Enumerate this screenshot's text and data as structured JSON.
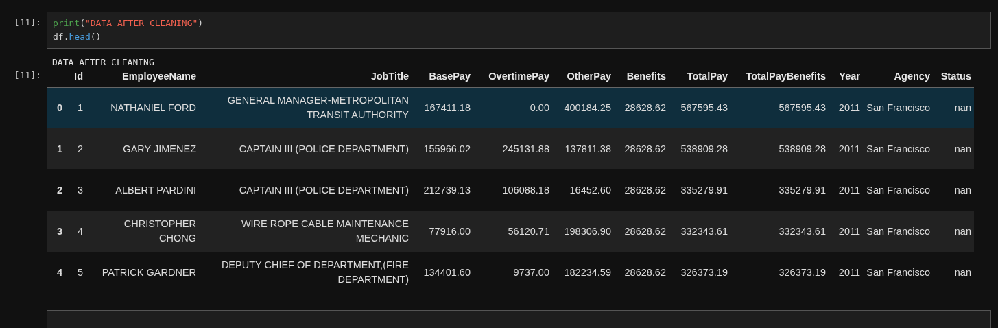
{
  "code_cell": {
    "prompt": "[11]:",
    "lines": [
      [
        {
          "kind": "func",
          "text": "print"
        },
        {
          "kind": "punct",
          "text": "("
        },
        {
          "kind": "string",
          "text": "\"DATA AFTER CLEANING\""
        },
        {
          "kind": "punct",
          "text": ")"
        }
      ],
      [
        {
          "kind": "plain",
          "text": "df."
        },
        {
          "kind": "method",
          "text": "head"
        },
        {
          "kind": "punct",
          "text": "()"
        }
      ]
    ]
  },
  "stdout": "DATA AFTER CLEANING",
  "output": {
    "prompt": "[11]:",
    "table": {
      "columns": [
        "",
        "Id",
        "EmployeeName",
        "JobTitle",
        "BasePay",
        "OvertimePay",
        "OtherPay",
        "Benefits",
        "TotalPay",
        "TotalPayBenefits",
        "Year",
        "Agency",
        "Status"
      ],
      "rows": [
        {
          "selected": true,
          "cells": [
            "0",
            "1",
            "NATHANIEL FORD",
            "GENERAL MANAGER-METROPOLITAN TRANSIT AUTHORITY",
            "167411.18",
            "0.00",
            "400184.25",
            "28628.62",
            "567595.43",
            "567595.43",
            "2011",
            "San Francisco",
            "nan"
          ]
        },
        {
          "selected": false,
          "cells": [
            "1",
            "2",
            "GARY JIMENEZ",
            "CAPTAIN III (POLICE DEPARTMENT)",
            "155966.02",
            "245131.88",
            "137811.38",
            "28628.62",
            "538909.28",
            "538909.28",
            "2011",
            "San Francisco",
            "nan"
          ]
        },
        {
          "selected": false,
          "cells": [
            "2",
            "3",
            "ALBERT PARDINI",
            "CAPTAIN III (POLICE DEPARTMENT)",
            "212739.13",
            "106088.18",
            "16452.60",
            "28628.62",
            "335279.91",
            "335279.91",
            "2011",
            "San Francisco",
            "nan"
          ]
        },
        {
          "selected": false,
          "cells": [
            "3",
            "4",
            "CHRISTOPHER CHONG",
            "WIRE ROPE CABLE MAINTENANCE MECHANIC",
            "77916.00",
            "56120.71",
            "198306.90",
            "28628.62",
            "332343.61",
            "332343.61",
            "2011",
            "San Francisco",
            "nan"
          ]
        },
        {
          "selected": false,
          "cells": [
            "4",
            "5",
            "PATRICK GARDNER",
            "DEPUTY CHIEF OF DEPARTMENT,(FIRE DEPARTMENT)",
            "134401.60",
            "9737.00",
            "182234.59",
            "28628.62",
            "326373.19",
            "326373.19",
            "2011",
            "San Francisco",
            "nan"
          ]
        }
      ]
    }
  }
}
